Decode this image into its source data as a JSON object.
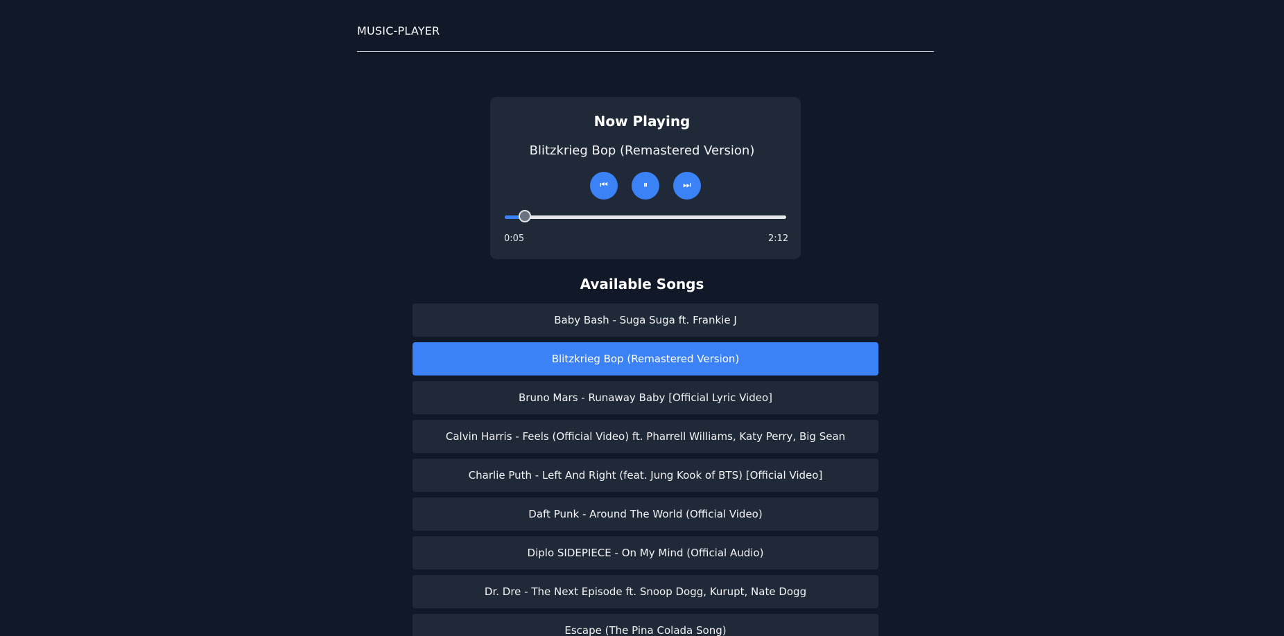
{
  "header": {
    "brand": "MUSIC-PLAYER"
  },
  "player": {
    "heading": "Now Playing",
    "current_song": "Blitzkrieg Bop (Remastered Version)",
    "controls": {
      "prev_label": "⏮",
      "pause_label": "⏸",
      "next_label": "⏭"
    },
    "elapsed": "0:05",
    "duration": "2:12",
    "progress_fraction": 0.038
  },
  "songs": {
    "heading": "Available Songs",
    "active_index": 1,
    "items": [
      {
        "label": "Baby Bash - Suga Suga ft. Frankie J"
      },
      {
        "label": "Blitzkrieg Bop (Remastered Version)"
      },
      {
        "label": "Bruno Mars - Runaway Baby [Official Lyric Video]"
      },
      {
        "label": "Calvin Harris - Feels (Official Video) ft. Pharrell Williams, Katy Perry, Big Sean"
      },
      {
        "label": "Charlie Puth - Left And Right (feat. Jung Kook of BTS) [Official Video]"
      },
      {
        "label": "Daft Punk - Around The World (Official Video)"
      },
      {
        "label": "Diplo SIDEPIECE - On My Mind (Official Audio)"
      },
      {
        "label": "Dr. Dre - The Next Episode ft. Snoop Dogg, Kurupt, Nate Dogg"
      },
      {
        "label": "Escape (The Pina Colada Song)"
      }
    ]
  },
  "colors": {
    "background": "#111827",
    "card": "#1f2937",
    "accent": "#3b82f6",
    "track": "#e5e7eb"
  },
  "icons": {
    "prev": "skip-previous-icon",
    "pause": "pause-icon",
    "next": "skip-next-icon"
  }
}
